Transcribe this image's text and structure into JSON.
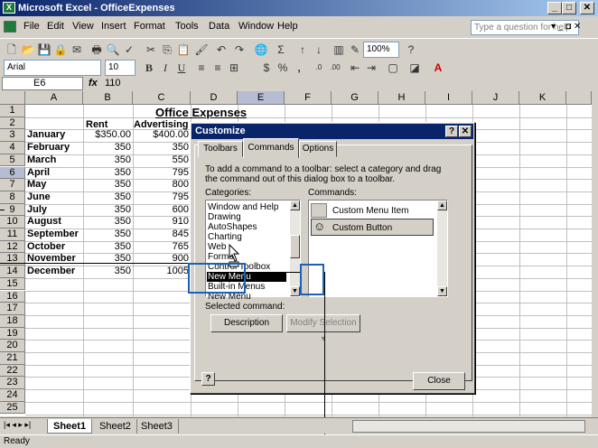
{
  "window": {
    "title": "Microsoft Excel - OfficeExpenses",
    "min": "_",
    "max": "□",
    "close": "✕"
  },
  "menu": [
    "File",
    "Edit",
    "View",
    "Insert",
    "Format",
    "Tools",
    "Data",
    "Window",
    "Help"
  ],
  "ask_placeholder": "Type a question for help",
  "toolbar": {
    "zoom": "100%",
    "font": "Arial",
    "size": "10",
    "bold": "B",
    "italic": "I",
    "underline": "U",
    "currency": "$",
    "percent": "%",
    "comma": ","
  },
  "formula": {
    "cell_ref": "E6",
    "fx": "fx",
    "value": "110"
  },
  "columns": [
    "A",
    "B",
    "C",
    "D",
    "E",
    "F",
    "G",
    "H",
    "I",
    "J",
    "K"
  ],
  "rows": [
    "1",
    "2",
    "3",
    "4",
    "5",
    "6",
    "7",
    "8",
    "9",
    "10",
    "11",
    "12",
    "13",
    "14",
    "15",
    "16",
    "17",
    "18",
    "19",
    "20",
    "21",
    "22",
    "23",
    "24",
    "25"
  ],
  "sheet": {
    "title": "Office Expenses",
    "headers": {
      "rent": "Rent",
      "advertising": "Advertising"
    },
    "data": [
      [
        "January",
        "$350.00",
        "$400.00"
      ],
      [
        "February",
        "350",
        "350"
      ],
      [
        "March",
        "350",
        "550"
      ],
      [
        "April",
        "350",
        "795"
      ],
      [
        "May",
        "350",
        "800"
      ],
      [
        "June",
        "350",
        "795"
      ],
      [
        "July",
        "350",
        "600"
      ],
      [
        "August",
        "350",
        "910"
      ],
      [
        "September",
        "350",
        "845"
      ],
      [
        "October",
        "350",
        "765"
      ],
      [
        "November",
        "350",
        "900"
      ],
      [
        "December",
        "350",
        "1005"
      ]
    ]
  },
  "dialog": {
    "title": "Customize",
    "help": "?",
    "close": "✕",
    "tabs": [
      "Toolbars",
      "Commands",
      "Options"
    ],
    "instructions": "To add a command to a toolbar: select a category and drag the command out of this dialog box to a toolbar.",
    "categories_label": "Categories:",
    "commands_label": "Commands:",
    "categories": [
      "Window and Help",
      "Drawing",
      "AutoShapes",
      "Charting",
      "Web",
      "Forms",
      "Control Toolbox",
      "New Menu",
      "Built-in Menus",
      "New Menu"
    ],
    "commands": [
      "Custom Menu Item",
      "Custom Button"
    ],
    "selected_command_label": "Selected command:",
    "description_btn": "Description",
    "modify_btn": "Modify Selection ▾",
    "close_btn": "Close",
    "help_btn": "?"
  },
  "sheet_tabs": [
    "Sheet1",
    "Sheet2",
    "Sheet3"
  ],
  "status": "Ready"
}
